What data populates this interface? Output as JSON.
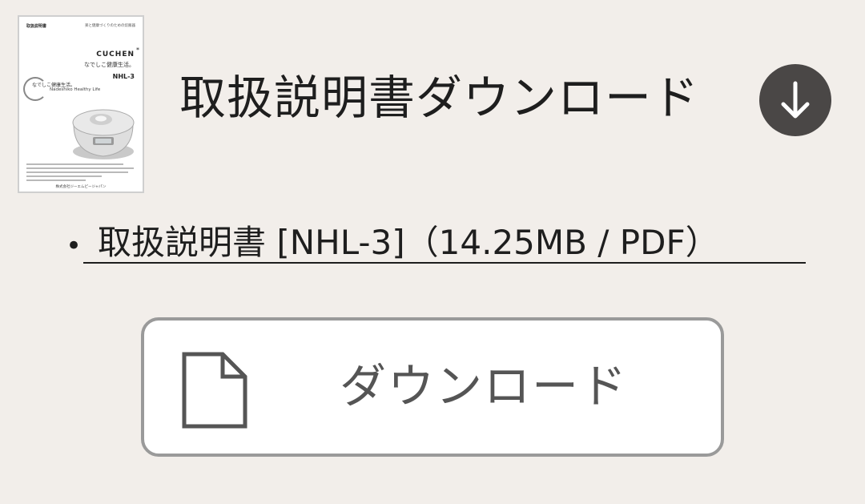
{
  "thumbnail": {
    "header_left": "取扱説明書",
    "header_right": "楽と健康づくりのための炊飯器",
    "brand": "CUCHEN",
    "sub_brand": "なでしこ健康生活。",
    "model": "NHL-3",
    "logo_jp": "なでしこ健康生活。",
    "logo_en": "Nadeshiko Healthy Life",
    "footer": "株式会社ジーエムピージャパン"
  },
  "heading": "取扱説明書ダウンロード",
  "file_link": {
    "bullet": "•",
    "text": "取扱説明書 [NHL-3]（14.25MB / PDF）"
  },
  "download_button": {
    "label": "ダウンロード",
    "icon": "document-icon"
  },
  "colors": {
    "background": "#f2eeea",
    "text": "#1e1e1e",
    "circle": "#4a4746",
    "button_border": "#9a9a9a",
    "button_text": "#555555"
  }
}
